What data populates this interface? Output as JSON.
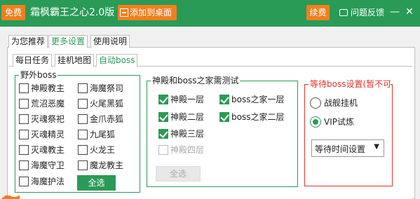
{
  "titlebar": {
    "badge": "免费",
    "title": "霜枫霸王之心2.0版",
    "add_desktop": "添加到桌面",
    "renew": "续费",
    "feedback": "问题反馈",
    "minimize": "—",
    "close": "✕"
  },
  "tabs": [
    "为您推荐",
    "更多设置",
    "使用说明"
  ],
  "subtabs": [
    "每日任务",
    "挂机地图",
    "自动boss"
  ],
  "wild_boss": {
    "title": "野外boss",
    "items": [
      "神殿教主",
      "荒沼恶魔",
      "灭魂祭祀",
      "灭魂精灵",
      "灭魂教主",
      "海魔守卫",
      "海魔护法",
      "海魔祭司",
      "火尾黑狐",
      "金爪赤狐",
      "九尾狐",
      "火龙王",
      "魔龙教主"
    ],
    "select_all": "全选"
  },
  "temple": {
    "title": "神殿和boss之家需测试",
    "items": [
      "神殿一层",
      "神殿二层",
      "神殿三层",
      "神殿四层",
      "boss之家一层",
      "boss之家二层"
    ],
    "select_all": "全选"
  },
  "waiting": {
    "title": "等待boss设置(暂不可用",
    "radio1": "战舰挂机",
    "radio2": "VIP试炼",
    "select": "等待时间设置",
    "arrow": "▼"
  },
  "colors": {
    "brand": "#2a9a57",
    "accent": "#f07f1e",
    "warning": "#e2332c"
  }
}
